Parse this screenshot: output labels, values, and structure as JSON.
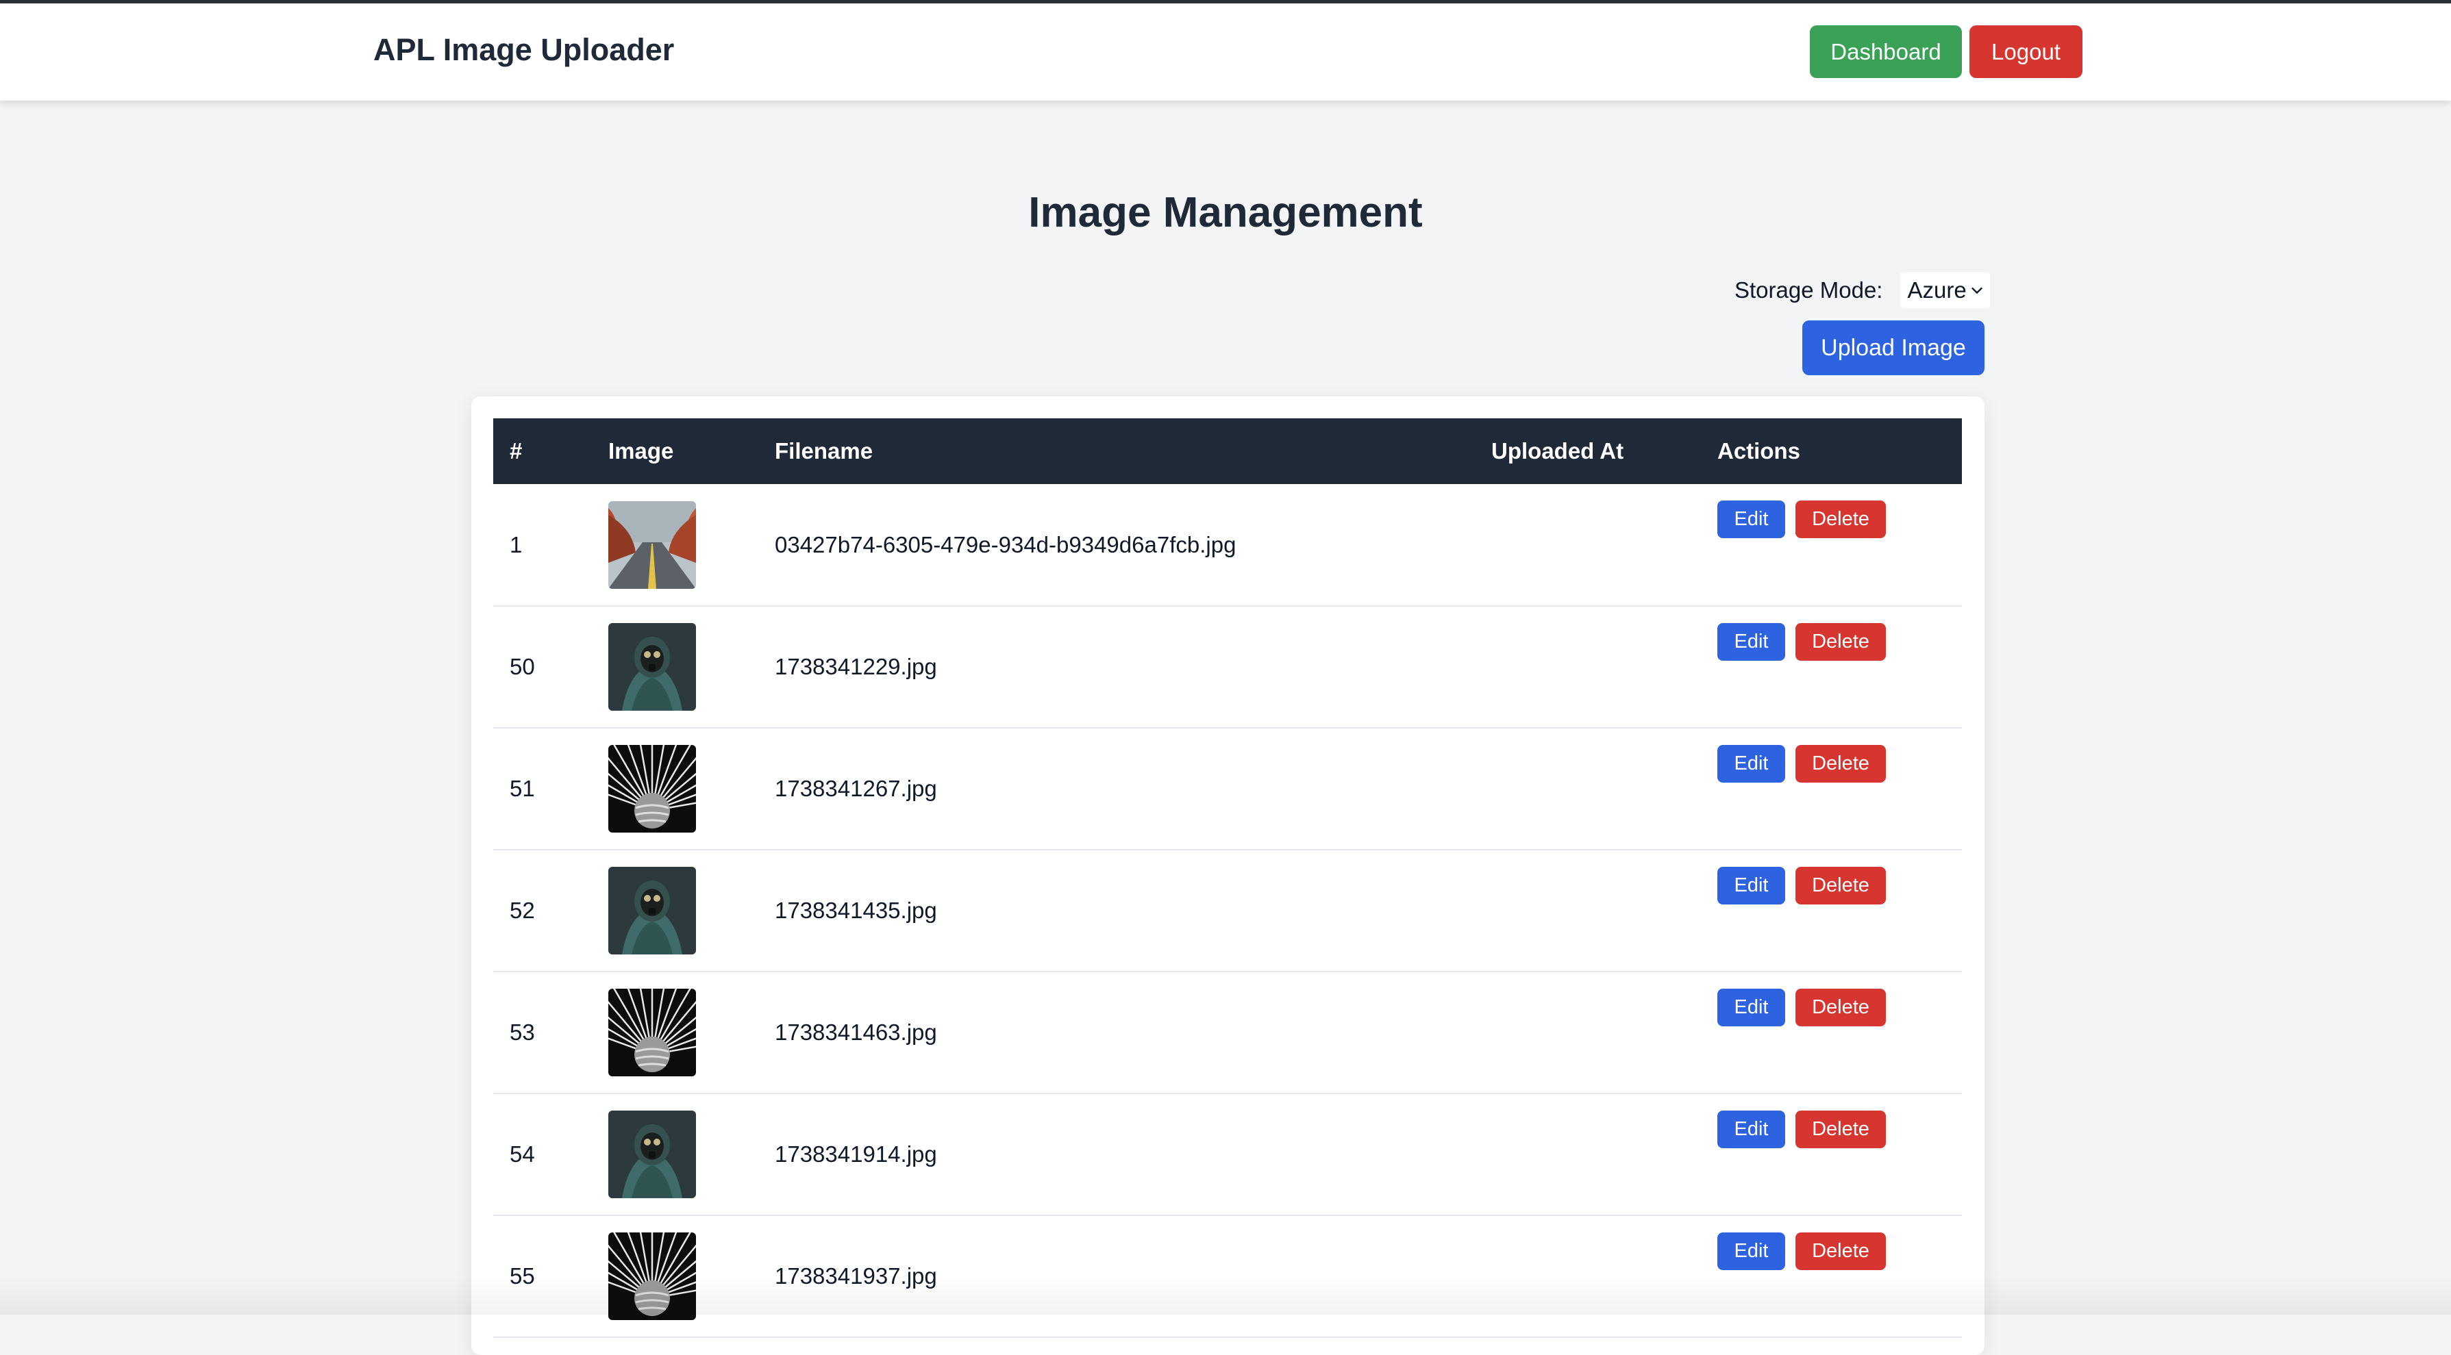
{
  "app": {
    "brand": "APL Image Uploader",
    "nav": {
      "dashboard": "Dashboard",
      "logout": "Logout"
    }
  },
  "page": {
    "title": "Image Management",
    "storage_label": "Storage Mode:",
    "storage_value": "Azure",
    "upload_label": "Upload Image"
  },
  "table": {
    "headers": {
      "num": "#",
      "image": "Image",
      "filename": "Filename",
      "uploaded": "Uploaded At",
      "actions": "Actions"
    },
    "actions": {
      "edit": "Edit",
      "delete": "Delete"
    },
    "rows": [
      {
        "num": "1",
        "filename": "03427b74-6305-479e-934d-b9349d6a7fcb.jpg",
        "uploaded": "",
        "thumb": "autumn-road"
      },
      {
        "num": "50",
        "filename": "1738341229.jpg",
        "uploaded": "",
        "thumb": "gas-mask-figure"
      },
      {
        "num": "51",
        "filename": "1738341267.jpg",
        "uploaded": "",
        "thumb": "striped-sphere"
      },
      {
        "num": "52",
        "filename": "1738341435.jpg",
        "uploaded": "",
        "thumb": "gas-mask-figure"
      },
      {
        "num": "53",
        "filename": "1738341463.jpg",
        "uploaded": "",
        "thumb": "striped-sphere"
      },
      {
        "num": "54",
        "filename": "1738341914.jpg",
        "uploaded": "",
        "thumb": "gas-mask-figure"
      },
      {
        "num": "55",
        "filename": "1738341937.jpg",
        "uploaded": "",
        "thumb": "striped-sphere"
      }
    ]
  },
  "colors": {
    "navbar_bg": "#ffffff",
    "page_bg": "#f3f4f6",
    "header_bg": "#1f2937",
    "primary": "#2d63e0",
    "danger": "#d6362f",
    "success": "#3aa157"
  }
}
